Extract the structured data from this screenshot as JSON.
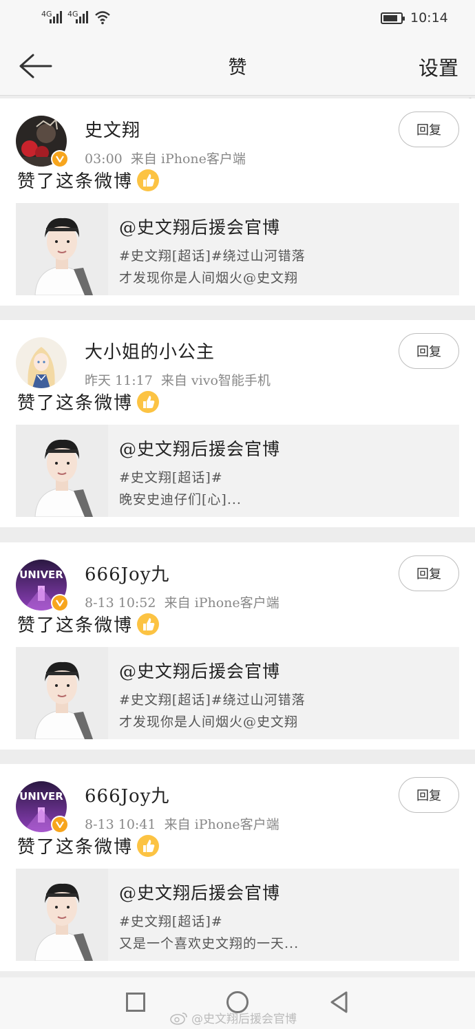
{
  "status_bar": {
    "net1": "4G",
    "net2": "4G",
    "time": "10:14",
    "battery_level": 0.85
  },
  "header": {
    "title": "赞",
    "settings": "设置"
  },
  "reply_label": "回复",
  "notifications": [
    {
      "user": "史文翔",
      "verified": true,
      "time": "03:00",
      "source": "来自 iPhone客户端",
      "action": "赞了这条微博",
      "avatar": "dark-boxing",
      "post": {
        "author": "@史文翔后援会官博",
        "line1": "#史文翔[超话]#绕过山河错落",
        "line2": "才发现你是人间烟火@史文翔"
      }
    },
    {
      "user": "大小姐的小公主",
      "verified": false,
      "time": "昨天 11:17",
      "source": "来自 vivo智能手机",
      "action": "赞了这条微博",
      "avatar": "anime-girl",
      "post": {
        "author": "@史文翔后援会官博",
        "line1": "#史文翔[超话]#",
        "line2": "晚安史迪仔们[心]..."
      }
    },
    {
      "user": "666Joy九",
      "verified": true,
      "time": "8-13 10:52",
      "source": "来自 iPhone客户端",
      "action": "赞了这条微博",
      "avatar": "univer-purple",
      "post": {
        "author": "@史文翔后援会官博",
        "line1": "#史文翔[超话]#绕过山河错落",
        "line2": "才发现你是人间烟火@史文翔"
      }
    },
    {
      "user": "666Joy九",
      "verified": true,
      "time": "8-13 10:41",
      "source": "来自 iPhone客户端",
      "action": "赞了这条微博",
      "avatar": "univer-purple",
      "post": {
        "author": "@史文翔后援会官博",
        "line1": "#史文翔[超话]#",
        "line2": "又是一个喜欢史文翔的一天..."
      }
    }
  ],
  "avatar_text": "UNIVER",
  "watermark": "@史文翔后援会官博"
}
